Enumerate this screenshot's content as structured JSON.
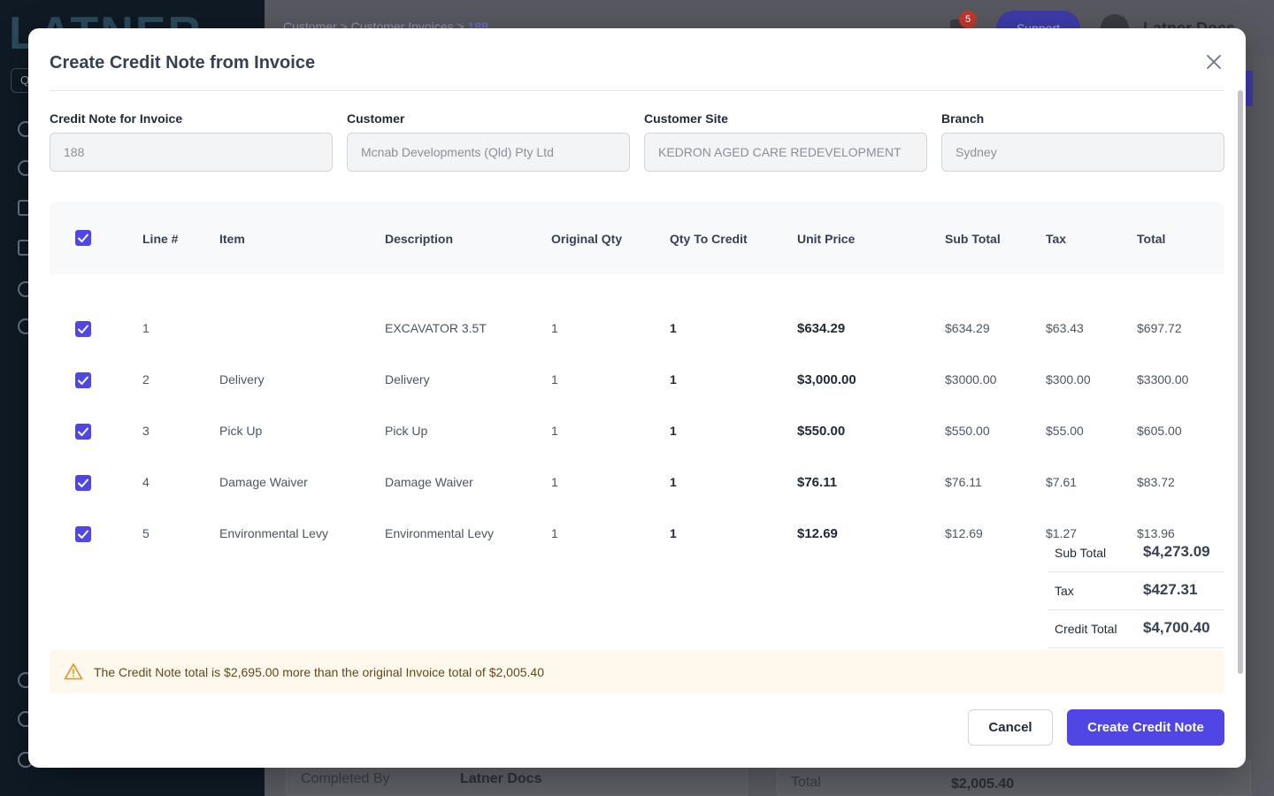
{
  "background": {
    "logo": "LATNER",
    "search_placeholder": "Q",
    "breadcrumb": [
      "Customer",
      "Customer Invoices",
      "188"
    ],
    "notification_count": "5",
    "support_label": "Support",
    "user_name": "Latner Docs",
    "completed_by_label": "Completed By",
    "completed_by_value": "Latner Docs",
    "total_label": "Total",
    "total_value": "$2,005.40"
  },
  "modal": {
    "title": "Create Credit Note from Invoice",
    "fields": [
      {
        "label": "Credit Note for Invoice",
        "value": "188"
      },
      {
        "label": "Customer",
        "value": "Mcnab Developments (Qld) Pty Ltd"
      },
      {
        "label": "Customer Site",
        "value": "KEDRON AGED CARE REDEVELOPMENT"
      },
      {
        "label": "Branch",
        "value": "Sydney"
      }
    ],
    "table": {
      "headers": {
        "line": "Line #",
        "item": "Item",
        "description": "Description",
        "original_qty": "Original Qty",
        "qty_to_credit": "Qty To Credit",
        "unit_price": "Unit Price",
        "sub_total": "Sub Total",
        "tax": "Tax",
        "total": "Total"
      },
      "rows": [
        {
          "line": "1",
          "item": "",
          "description": "EXCAVATOR 3.5T",
          "original_qty": "1",
          "qty_to_credit": "1",
          "unit_price": "$634.29",
          "sub_total": "$634.29",
          "tax": "$63.43",
          "total": "$697.72",
          "checked": true
        },
        {
          "line": "2",
          "item": "Delivery",
          "description": "Delivery",
          "original_qty": "1",
          "qty_to_credit": "1",
          "unit_price": "$3,000.00",
          "sub_total": "$3000.00",
          "tax": "$300.00",
          "total": "$3300.00",
          "checked": true
        },
        {
          "line": "3",
          "item": "Pick Up",
          "description": "Pick Up",
          "original_qty": "1",
          "qty_to_credit": "1",
          "unit_price": "$550.00",
          "sub_total": "$550.00",
          "tax": "$55.00",
          "total": "$605.00",
          "checked": true
        },
        {
          "line": "4",
          "item": "Damage Waiver",
          "description": "Damage Waiver",
          "original_qty": "1",
          "qty_to_credit": "1",
          "unit_price": "$76.11",
          "sub_total": "$76.11",
          "tax": "$7.61",
          "total": "$83.72",
          "checked": true
        },
        {
          "line": "5",
          "item": "Environmental Levy",
          "description": "Environmental Levy",
          "original_qty": "1",
          "qty_to_credit": "1",
          "unit_price": "$12.69",
          "sub_total": "$12.69",
          "tax": "$1.27",
          "total": "$13.96",
          "checked": true
        }
      ]
    },
    "totals": [
      {
        "label": "Sub Total",
        "value": "$4,273.09"
      },
      {
        "label": "Tax",
        "value": "$427.31"
      },
      {
        "label": "Credit Total",
        "value": "$4,700.40"
      }
    ],
    "warning": "The Credit Note total is $2,695.00 more than the original Invoice total of $2,005.40",
    "cancel_label": "Cancel",
    "create_label": "Create Credit Note"
  },
  "colors": {
    "accent": "#4f46e5",
    "warning_bg": "#fff8ed",
    "warning_icon": "#e0a030"
  },
  "icons": {
    "close": "close-icon",
    "checkbox": "checkmark-icon",
    "warning": "warning-triangle-icon"
  }
}
